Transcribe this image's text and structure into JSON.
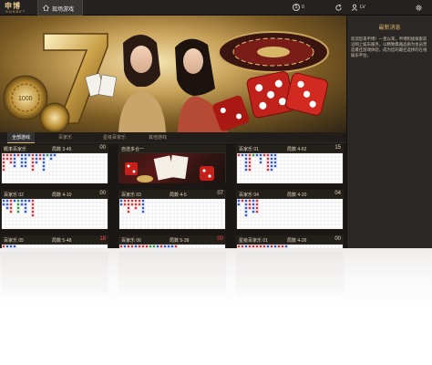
{
  "brand": {
    "name_cn": "申博",
    "name_en": "SUNBET"
  },
  "topbar": {
    "live_label": "现场游戏",
    "balance": "0",
    "user": "LV"
  },
  "notice": {
    "title": "最新消息",
    "body": "欢迎您来申博！一直以来，申博积极探索前沿网上娱乐服务，以精致典雅品质为会员营造最佳游戏体验，成为您的最佳选择的在线娱乐平台。"
  },
  "tabs": [
    "全部游戏",
    "百家乐",
    "星级百家乐",
    "其他游戏"
  ],
  "active_tab": 0,
  "cards": [
    {
      "name": "概率百家乐",
      "round_label": "局数",
      "round": "3-45",
      "timer": "00",
      "timer_red": false
    },
    {
      "name": "自选多合一",
      "multi": true
    },
    {
      "name": "百家乐 01",
      "round_label": "局数",
      "round": "4-62",
      "timer": "15",
      "timer_red": false
    },
    {
      "name": "百家乐 02",
      "round_label": "局数",
      "round": "4-10",
      "timer": "00",
      "timer_red": false
    },
    {
      "name": "百家乐 03",
      "round_label": "局数",
      "round": "4-5",
      "timer": "07",
      "timer_red": false
    },
    {
      "name": "百家乐 04",
      "round_label": "局数",
      "round": "4-20",
      "timer": "04",
      "timer_red": false
    },
    {
      "name": "百家乐 05",
      "round_label": "局数",
      "round": "5-48",
      "timer": "18",
      "timer_red": true
    },
    {
      "name": "百家乐 06",
      "round_label": "局数",
      "round": "5-39",
      "timer": "00",
      "timer_red": true
    },
    {
      "name": "星级百家乐 01",
      "round_label": "局数",
      "round": "4-26",
      "timer": "00",
      "timer_red": false
    }
  ],
  "colors": {
    "accent": "#e2b867",
    "banker": "#d9343a",
    "player": "#2f5bd6",
    "tie": "#2f9c3f"
  }
}
